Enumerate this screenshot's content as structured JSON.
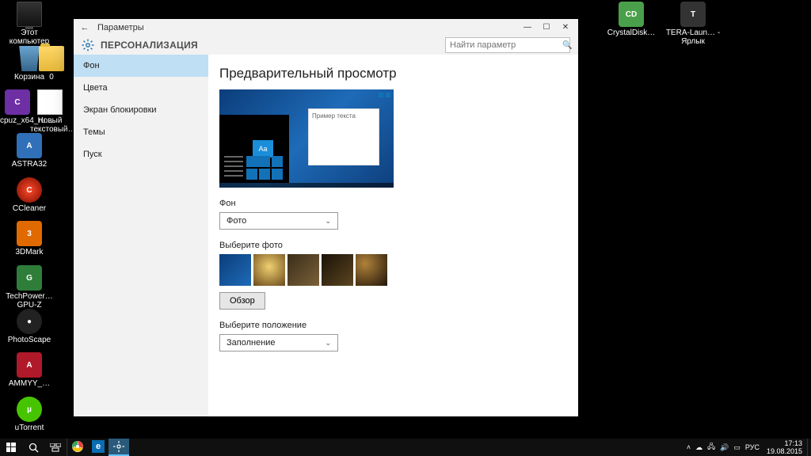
{
  "desktop_icons": {
    "this_pc": "Этот компьютер",
    "recycle": "Корзина",
    "folder0": "0",
    "cpuz": "cpuz_x64_ru…",
    "newtxt": "Новый текстовый…",
    "astra": "ASTRA32",
    "ccleaner": "CCleaner",
    "threedmark": "3DMark",
    "techpower": "TechPower… GPU-Z",
    "photoscape": "PhotoScape",
    "ammyy": "AMMYY_…",
    "utorrent": "uTorrent",
    "crystal": "CrystalDisk…",
    "tera": "TERA-Laun… - Ярлык"
  },
  "window": {
    "title": "Параметры",
    "section": "ПЕРСОНАЛИЗАЦИЯ",
    "search_placeholder": "Найти параметр"
  },
  "sidebar": {
    "items": [
      "Фон",
      "Цвета",
      "Экран блокировки",
      "Темы",
      "Пуск"
    ],
    "active_index": 0
  },
  "content": {
    "preview_heading": "Предварительный просмотр",
    "sample_text": "Пример текста",
    "aa": "Aa",
    "bg_label": "Фон",
    "bg_value": "Фото",
    "choose_photo": "Выберите фото",
    "browse": "Обзор",
    "position_label": "Выберите положение",
    "position_value": "Заполнение"
  },
  "taskbar": {
    "lang": "РУС",
    "time": "17:13",
    "date": "19.08.2015"
  }
}
